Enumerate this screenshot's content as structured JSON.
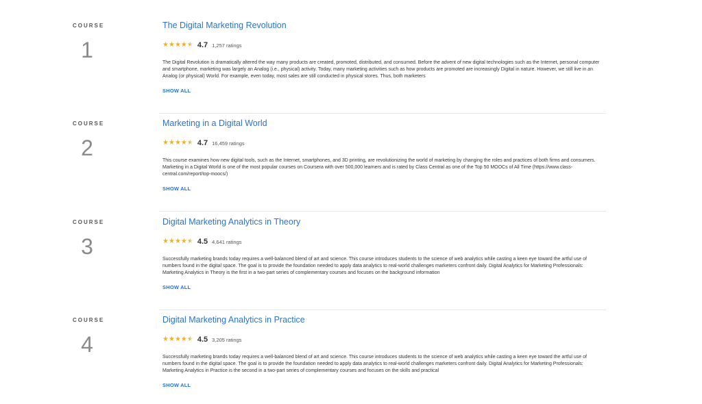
{
  "label": "COURSE",
  "show_all_label": "SHOW ALL",
  "colors": {
    "link": "#2a73cc",
    "star": "#f2b01e"
  },
  "courses": [
    {
      "number": "1",
      "title": "The Digital Marketing Revolution",
      "rating": "4.7",
      "ratings_count": "1,257 ratings",
      "description": "The Digital Revolution is dramatically altered the way many products are created, promoted, distributed, and consumed. Before the advent of new digital technologies such as the Internet, personal computer and smartphone, marketing was largely an Analog (i.e., physical) activity. Today, many marketing activities such as how products are promoted are increasingly Digital in nature. However, we still live in an Analog (or physical) World. For example, even today, most sales are still conducted in physical stores. Thus, both marketers"
    },
    {
      "number": "2",
      "title": "Marketing in a Digital World",
      "rating": "4.7",
      "ratings_count": "16,459 ratings",
      "description": "This course examines how new digital tools, such as the Internet, smartphones, and 3D printing, are revolutionizing the world of marketing by changing the roles and practices of both firms and consumers. Marketing in a Digital World is one of the most popular courses on Coursera with over 500,000 learners and is rated by Class Central as one of the Top 50 MOOCs of All Time (https://www.class-central.com/report/top-moocs/)"
    },
    {
      "number": "3",
      "title": "Digital Marketing Analytics in Theory",
      "rating": "4.5",
      "ratings_count": "4,641 ratings",
      "description": "Successfully marketing brands today requires a well-balanced blend of art and science. This course introduces students to the science of web analytics while casting a keen eye toward the artful use of numbers found in the digital space. The goal is to provide the foundation needed to apply data analytics to real-world challenges marketers confront daily. Digital Analytics for Marketing Professionals: Marketing Analytics in Theory is the first in a two-part series of complementary courses and focuses on the background information"
    },
    {
      "number": "4",
      "title": "Digital Marketing Analytics in Practice",
      "rating": "4.5",
      "ratings_count": "3,205 ratings",
      "description": "Successfully marketing brands today requires a well-balanced blend of art and science. This course introduces students to the science of web analytics while casting a keen eye toward the artful use of numbers found in the digital space. The goal is to provide the foundation needed to apply data analytics to real-world challenges marketers confront daily. Digital Analytics for Marketing Professionals: Marketing Analytics in Practice is the second in a two-part series of complementary courses and focuses on the skills and practical"
    }
  ]
}
